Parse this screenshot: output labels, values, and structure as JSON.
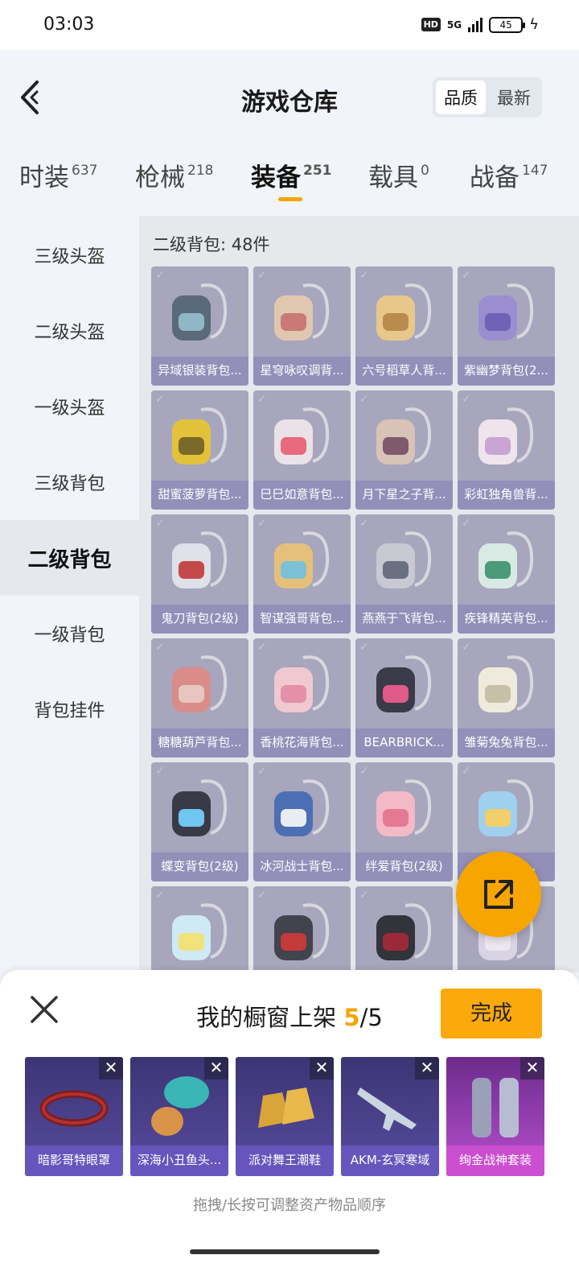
{
  "status": {
    "time": "03:03",
    "hd": "HD",
    "network": "5G",
    "battery": "45"
  },
  "header": {
    "title": "游戏仓库",
    "sort": [
      "品质",
      "最新"
    ]
  },
  "tabs": [
    {
      "label": "时装",
      "count": "637"
    },
    {
      "label": "枪械",
      "count": "218"
    },
    {
      "label": "装备",
      "count": "251"
    },
    {
      "label": "载具",
      "count": "0"
    },
    {
      "label": "战备",
      "count": "147"
    }
  ],
  "sidebar": [
    "三级头盔",
    "二级头盔",
    "一级头盔",
    "三级背包",
    "二级背包",
    "一级背包",
    "背包挂件"
  ],
  "main": {
    "count_label": "二级背包: 48件",
    "items": [
      "异域银装背包...",
      "星穹咏叹调背...",
      "六号稻草人背...",
      "紫幽梦背包(2...",
      "甜蜜菠萝背包...",
      "巳巳如意背包...",
      "月下星之子背...",
      "彩虹独角兽背...",
      "鬼刀背包(2级)",
      "智谋强哥背包...",
      "燕燕于飞背包...",
      "疾锋精英背包...",
      "糖糖葫芦背包...",
      "香桃花海背包...",
      "BEARBRICK...",
      "雏菊兔兔背包...",
      "蝶变背包(2级)",
      "冰河战士背包...",
      "绊爱背包(2级)",
      "纯...背包..."
    ]
  },
  "sheet": {
    "title_prefix": "我的橱窗上架 ",
    "current": "5",
    "total": "/5",
    "done_label": "完成",
    "items": [
      "暗影哥特眼罩",
      "深海小丑鱼头...",
      "派对舞王潮鞋",
      "AKM-玄冥寒域",
      "绚金战神套装"
    ],
    "hint": "拖拽/长按可调整资产物品顺序"
  },
  "colors": {
    "accent": "#f5a300",
    "card": "#a7a6bd",
    "card_label": "#928fb9"
  }
}
